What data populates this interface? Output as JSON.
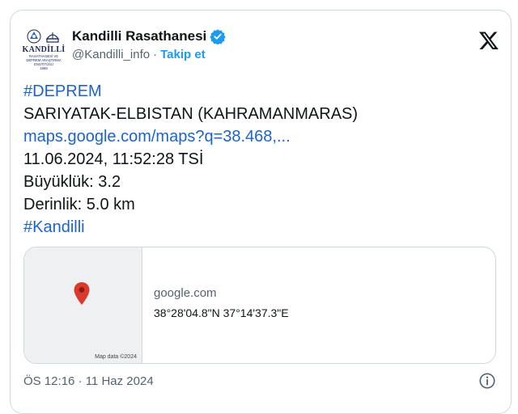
{
  "account": {
    "display_name": "Kandilli Rasathanesi",
    "handle": "@Kandilli_info",
    "separator": "·",
    "follow_label": "Takip et",
    "avatar": {
      "name": "KANDİLLİ",
      "sub1": "RASATHANESİ VE",
      "sub2": "DEPREM ARAŞTIRMA",
      "sub3": "ENSTİTÜSÜ",
      "year": "1868"
    }
  },
  "tweet": {
    "hashtag1": "#DEPREM",
    "location": "SARIYATAK-ELBISTAN (KAHRAMANMARAS)",
    "map_link": "maps.google.com/maps?q=38.468,...",
    "datetime": "11.06.2024, 11:52:28 TSİ",
    "magnitude": "Büyüklük: 3.2",
    "depth": "Derinlik: 5.0 km",
    "hashtag2": "#Kandilli"
  },
  "link_card": {
    "domain": "google.com",
    "title": "38°28'04.8\"N 37°14'37.3\"E",
    "map_attribution": "Map data ©2024"
  },
  "footer": {
    "timestamp": "ÖS 12:16 · 11 Haz 2024"
  },
  "colors": {
    "link": "#1d64c6",
    "verified": "#1d9bf0",
    "muted": "#536471",
    "map_pin": "#d93a2b"
  },
  "icons": [
    "verified-badge-icon",
    "x-logo-icon",
    "map-pin-icon",
    "info-icon"
  ]
}
